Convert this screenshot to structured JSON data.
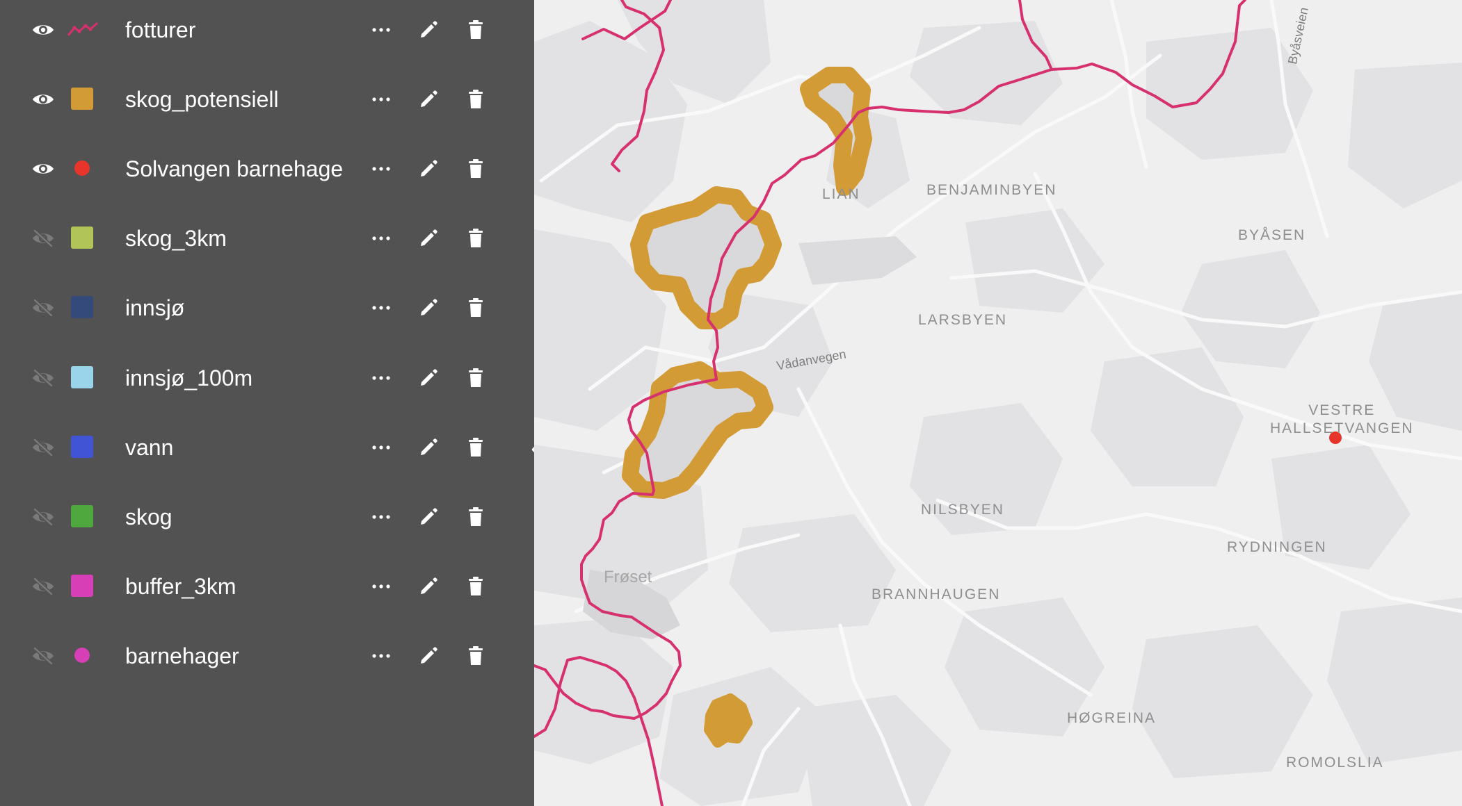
{
  "layers": [
    {
      "name": "fotturer",
      "visible": true,
      "symbol": "line",
      "color": "#d6316e"
    },
    {
      "name": "skog_potensiell",
      "visible": true,
      "symbol": "square",
      "color": "#d39b36"
    },
    {
      "name": "Solvangen barnehage",
      "visible": true,
      "symbol": "circle",
      "color": "#e8352b"
    },
    {
      "name": "skog_3km",
      "visible": false,
      "symbol": "square",
      "color": "#b1c457"
    },
    {
      "name": "innsjø",
      "visible": false,
      "symbol": "square",
      "color": "#344a7a"
    },
    {
      "name": "innsjø_100m",
      "visible": false,
      "symbol": "square",
      "color": "#9ad4ea"
    },
    {
      "name": "vann",
      "visible": false,
      "symbol": "square",
      "color": "#4254d6"
    },
    {
      "name": "skog",
      "visible": false,
      "symbol": "square",
      "color": "#4fa83d"
    },
    {
      "name": "buffer_3km",
      "visible": false,
      "symbol": "square",
      "color": "#d63fb6"
    },
    {
      "name": "barnehager",
      "visible": false,
      "symbol": "circle",
      "color": "#d63fb6"
    }
  ],
  "icons": {
    "visible": "eye-icon",
    "hidden": "eye-off-icon",
    "more": "more-horizontal-icon",
    "edit": "pencil-icon",
    "delete": "trash-icon",
    "collapse": "chevron-left-icon"
  },
  "map": {
    "place_labels": {
      "lian": "LIAN",
      "benjaminbyen": "BENJAMINBYEN",
      "byasen": "BYÅSEN",
      "larsbyen": "LARSBYEN",
      "vestre_hallsetvangen": "VESTRE\nHALLSETVANGEN",
      "nilsbyen": "NILSBYEN",
      "rydningen": "RYDNINGEN",
      "froset": "Frøset",
      "brannhaugen": "BRANNHAUGEN",
      "hogreina": "HØGREINA",
      "romolslia": "ROMOLSLIA"
    },
    "road_labels": {
      "vadanvegen": "Vådanvegen",
      "byasveien": "Byåsveien"
    },
    "colors": {
      "background": "#efeff0",
      "forest": "#e3e3e5",
      "water": "#d5d5d7",
      "trail": "#d6316e",
      "potential_forest": "#d39b36",
      "kindergarten": "#e8352b"
    }
  }
}
